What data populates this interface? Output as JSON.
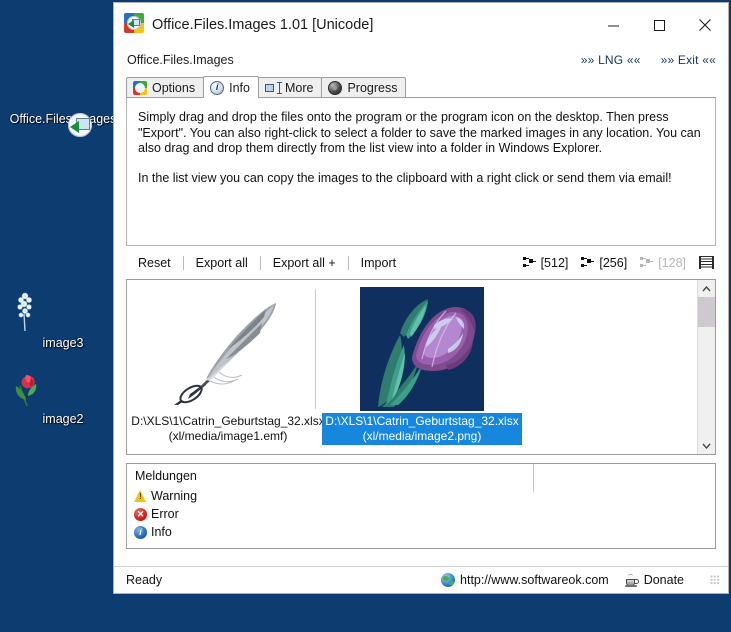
{
  "desktop": {
    "background_color": "#0d3c70",
    "icons": [
      {
        "label": "Office.Files.Images",
        "icon": "app-quad-icon"
      },
      {
        "label": "image3",
        "icon": "white-flower-icon"
      },
      {
        "label": "image2",
        "icon": "tulip-icon"
      }
    ]
  },
  "window": {
    "title": "Office.Files.Images 1.01 [Unicode]",
    "title_icon": "app-quad-icon",
    "controls": {
      "minimize": "—",
      "maximize": "☐",
      "close": "✕"
    },
    "subbar": {
      "app_name": "Office.Files.Images",
      "lng_link": "»» LNG ««",
      "exit_link": "»» Exit ««"
    },
    "tabs": [
      {
        "label": "Options",
        "icon": "options-icon",
        "active": false
      },
      {
        "label": "Info",
        "icon": "info-icon",
        "active": true
      },
      {
        "label": "More",
        "icon": "more-icon",
        "active": false
      },
      {
        "label": "Progress",
        "icon": "progress-icon",
        "active": false
      }
    ],
    "info_pane": {
      "paragraph1": "Simply drag and drop the files onto the program or the program icon on the desktop. Then press \"Export\". You can also right-click to select a folder to save the marked images in any location. You can also drag and drop them directly from the list view into a folder in Windows Explorer.",
      "paragraph2": "In the list view you can copy the images to the clipboard with a right click or send them via email!"
    },
    "toolbar": {
      "commands": [
        "Reset",
        "Export all",
        "Export all +",
        "Import"
      ],
      "sizes": [
        {
          "label": "[512]",
          "icon": "scale-icon",
          "enabled": true
        },
        {
          "label": "[256]",
          "icon": "scale-icon",
          "enabled": true
        },
        {
          "label": "[128]",
          "icon": "scale-icon",
          "enabled": false
        }
      ],
      "view_toggle_icon": "list-grid-icon"
    },
    "list_view": {
      "items": [
        {
          "thumb": "feather-quill-image",
          "caption_line1": "D:\\XLS\\1\\Catrin_Geburtstag_32.xlsx",
          "caption_line2": "(xl/media/image1.emf)",
          "selected": false
        },
        {
          "thumb": "tulip-image",
          "caption_line1": "D:\\XLS\\1\\Catrin_Geburtstag_32.xlsx",
          "caption_line2": "(xl/media/image2.png)",
          "selected": true
        }
      ],
      "selection_color": "#1787de",
      "scrollbar": {
        "up_arrow": "⌃",
        "down_arrow": "⌄"
      }
    },
    "messages": {
      "header": "Meldungen",
      "rows": [
        {
          "label": "Warning",
          "icon": "warning-icon"
        },
        {
          "label": "Error",
          "icon": "error-icon"
        },
        {
          "label": "Info",
          "icon": "info-circle-icon"
        }
      ]
    },
    "statusbar": {
      "status": "Ready",
      "website": "http://www.softwareok.com",
      "website_icon": "globe-icon",
      "donate": "Donate",
      "donate_icon": "coffee-cup-icon"
    }
  }
}
